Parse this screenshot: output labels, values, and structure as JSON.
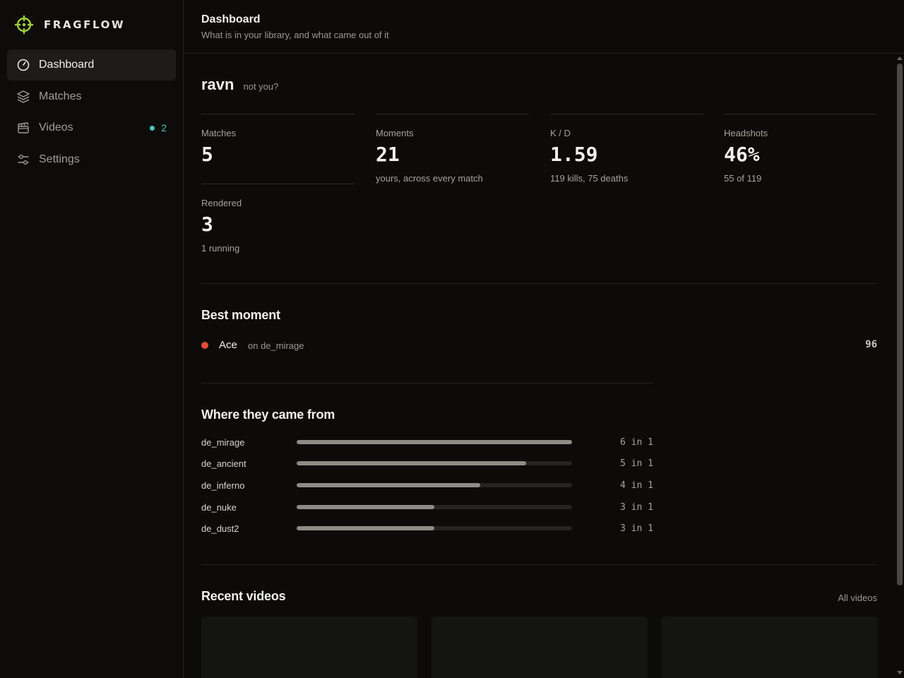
{
  "app": {
    "name": "FRAGFLOW",
    "accent": "#9ccf3a"
  },
  "sidebar": {
    "items": [
      {
        "label": "Dashboard",
        "icon": "gauge-icon",
        "active": true
      },
      {
        "label": "Matches",
        "icon": "layers-icon"
      },
      {
        "label": "Videos",
        "icon": "clapperboard-icon",
        "badge": "2"
      },
      {
        "label": "Settings",
        "icon": "sliders-icon"
      }
    ]
  },
  "header": {
    "title": "Dashboard",
    "subtitle": "What is in your library, and what came out of it"
  },
  "user": {
    "name": "ravn",
    "not_you": "not you?"
  },
  "stats": [
    {
      "label": "Matches",
      "value": "5",
      "sub": ""
    },
    {
      "label": "Moments",
      "value": "21",
      "sub": "yours, across every match"
    },
    {
      "label": "K / D",
      "value": "1.59",
      "sub": "119 kills, 75 deaths"
    },
    {
      "label": "Headshots",
      "value": "46%",
      "sub": "55 of 119"
    },
    {
      "label": "Rendered",
      "value": "3",
      "sub": "1 running"
    }
  ],
  "best_moment": {
    "title": "Best moment",
    "name": "Ace",
    "map": "on de_mirage",
    "score": "96",
    "color": "#e24a3b"
  },
  "where_from": {
    "title": "Where they came from",
    "rows": [
      {
        "map": "de_mirage",
        "count": "6 in 1",
        "value": 6
      },
      {
        "map": "de_ancient",
        "count": "5 in 1",
        "value": 5
      },
      {
        "map": "de_inferno",
        "count": "4 in 1",
        "value": 4
      },
      {
        "map": "de_nuke",
        "count": "3 in 1",
        "value": 3
      },
      {
        "map": "de_dust2",
        "count": "3 in 1",
        "value": 3
      }
    ],
    "max": 6
  },
  "recent_videos": {
    "title": "Recent videos",
    "all_link": "All videos"
  }
}
